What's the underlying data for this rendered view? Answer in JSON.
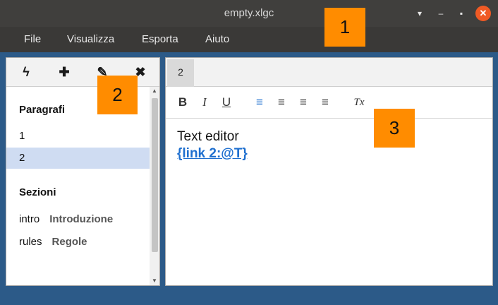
{
  "window": {
    "title": "empty.xlgc",
    "controls": {
      "menu_icon": "▾",
      "minimize_icon": "–",
      "maximize_icon": "▪",
      "close_icon": "✕"
    }
  },
  "menubar": {
    "items": [
      {
        "label": "File"
      },
      {
        "label": "Visualizza"
      },
      {
        "label": "Esporta"
      },
      {
        "label": "Aiuto"
      }
    ]
  },
  "left_toolbar": {
    "buttons": [
      {
        "icon": "lightning-icon",
        "glyph": "ϟ"
      },
      {
        "icon": "plus-icon",
        "glyph": "✚"
      },
      {
        "icon": "pencil-icon",
        "glyph": "✎"
      },
      {
        "icon": "close-icon",
        "glyph": "✖"
      }
    ]
  },
  "paragraphs": {
    "title": "Paragrafi",
    "items": [
      {
        "label": "1",
        "selected": false
      },
      {
        "label": "2",
        "selected": true
      }
    ]
  },
  "sections": {
    "title": "Sezioni",
    "items": [
      {
        "key": "intro",
        "name": "Introduzione"
      },
      {
        "key": "rules",
        "name": "Regole"
      }
    ]
  },
  "editor": {
    "tab_label": "2",
    "toolbar": {
      "bold": "B",
      "italic": "I",
      "underline": "U",
      "align_left": "≡",
      "align_center": "≡",
      "align_right": "≡",
      "justify": "≡",
      "clear_format": "Tx"
    },
    "content": {
      "text": "Text editor",
      "link": "{link 2:@T}"
    }
  },
  "callouts": [
    "1",
    "2",
    "3"
  ],
  "colors": {
    "accent": "#1e6fcf",
    "selection": "#cfdcf2",
    "callout": "#ff8c00",
    "close_button": "#f05a24",
    "background": "#2c5a88"
  }
}
